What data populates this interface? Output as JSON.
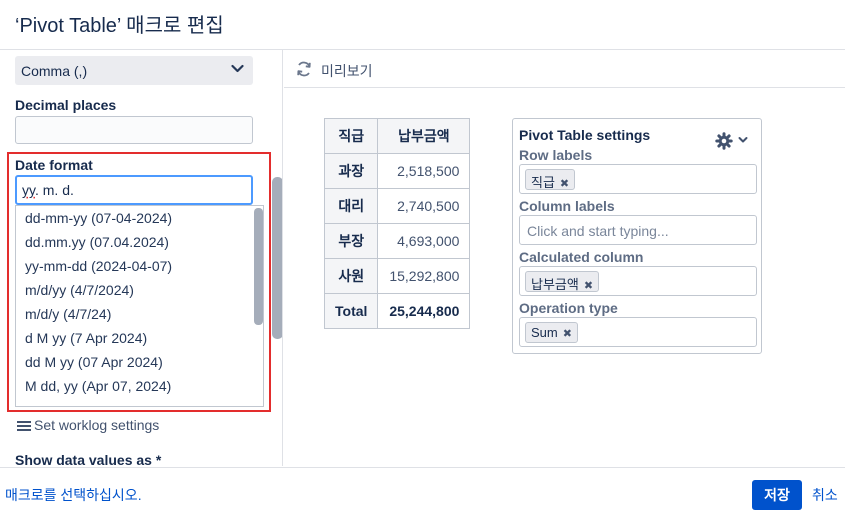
{
  "dialog": {
    "title": "‘Pivot Table’ 매크로 편집"
  },
  "left_panel": {
    "separator_select": {
      "value": "Comma (,)",
      "icon": "chevron-down-icon"
    },
    "decimal_places": {
      "label": "Decimal places",
      "value": ""
    },
    "date_format": {
      "label": "Date format",
      "input_value_prefix": "yy",
      "input_value_rest": ". m. d.",
      "options": [
        "dd-mm-yy (07-04-2024)",
        "dd.mm.yy (07.04.2024)",
        "yy-mm-dd (2024-04-07)",
        "m/d/yy (4/7/2024)",
        "m/d/y (4/7/24)",
        "d M yy (7 Apr 2024)",
        "dd M yy (07 Apr 2024)",
        "M dd, yy (Apr 07, 2024)"
      ]
    },
    "worklog_link": "Set worklog settings",
    "show_values_label": "Show data values as *"
  },
  "preview": {
    "title": "미리보기",
    "table": {
      "headers": [
        "직급",
        "납부금액"
      ],
      "rows": [
        {
          "label": "과장",
          "value": "2,518,500"
        },
        {
          "label": "대리",
          "value": "2,740,500"
        },
        {
          "label": "부장",
          "value": "4,693,000"
        },
        {
          "label": "사원",
          "value": "15,292,800"
        }
      ],
      "total": {
        "label": "Total",
        "value": "25,244,800"
      }
    },
    "settings": {
      "title": "Pivot Table settings",
      "row_labels": {
        "label": "Row labels",
        "chip": "직급"
      },
      "column_labels": {
        "label": "Column labels",
        "placeholder": "Click and start typing..."
      },
      "calculated_column": {
        "label": "Calculated column",
        "chip": "납부금액"
      },
      "operation_type": {
        "label": "Operation type",
        "chip": "Sum"
      },
      "chip_remove": "✖"
    }
  },
  "footer": {
    "select_macro_link": "매크로를 선택하십시오.",
    "save_label": "저장",
    "cancel_label": "취소"
  },
  "colors": {
    "primary": "#0052cc",
    "highlight_outline": "#e32d2d",
    "focus_border": "#4c9aff"
  }
}
